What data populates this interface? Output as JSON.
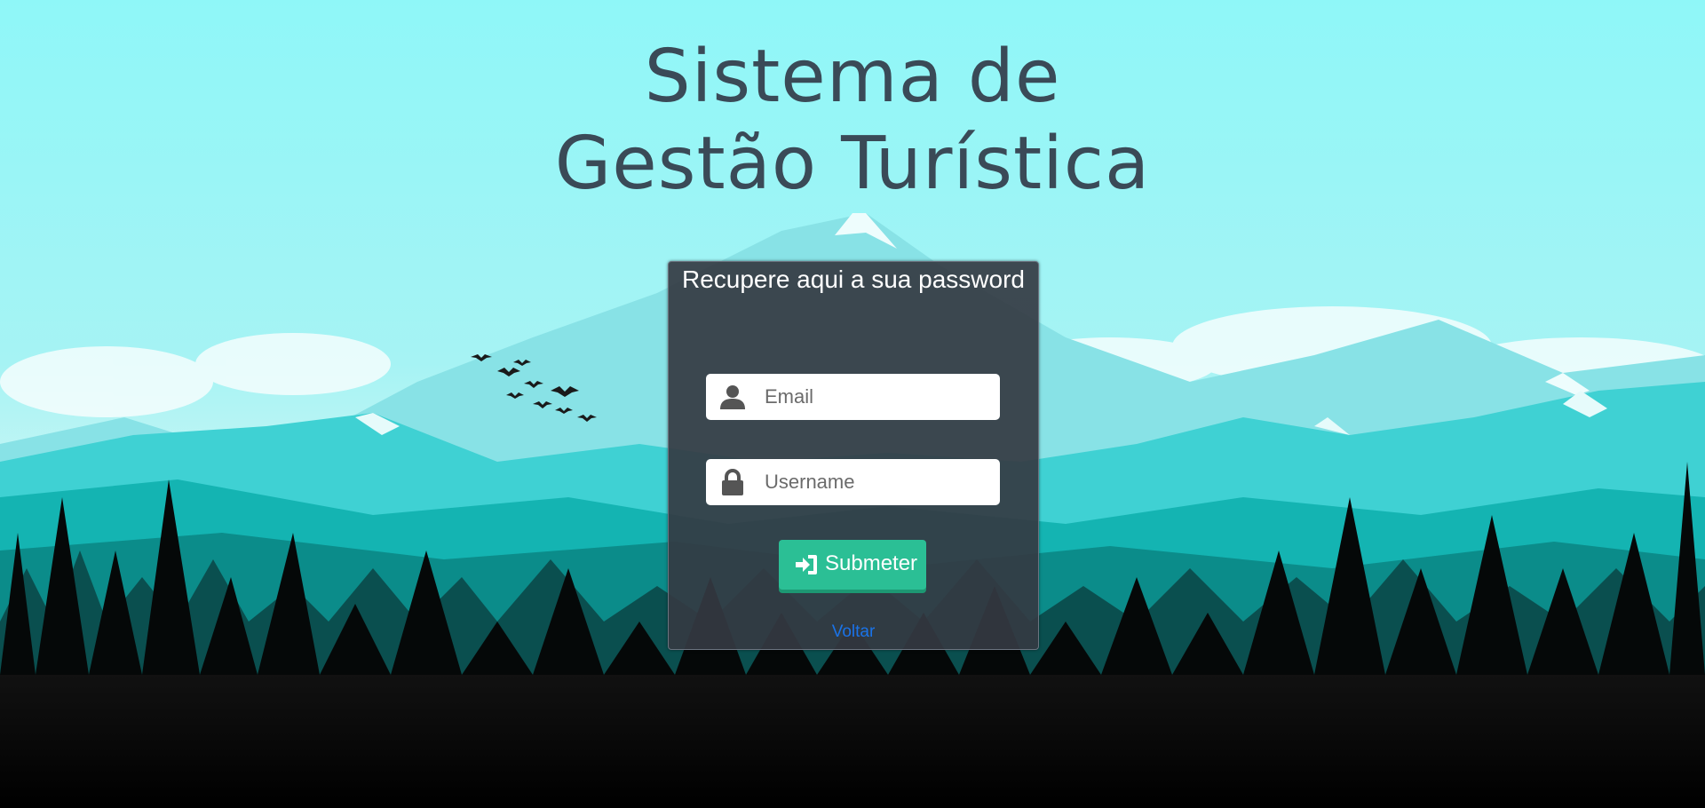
{
  "page": {
    "title_line1": "Sistema de",
    "title_line2": "Gestão Turística"
  },
  "form": {
    "heading": "Recupere aqui a sua password",
    "email": {
      "placeholder": "Email",
      "value": "",
      "icon": "user-icon"
    },
    "username": {
      "placeholder": "Username",
      "value": "",
      "icon": "lock-icon"
    },
    "submit_label": "Submeter",
    "submit_icon": "sign-in-icon",
    "back_link": "Voltar"
  },
  "colors": {
    "accent": "#2bbf95",
    "card": "#343a42",
    "link": "#1a73e8",
    "title": "#3a4a57"
  }
}
